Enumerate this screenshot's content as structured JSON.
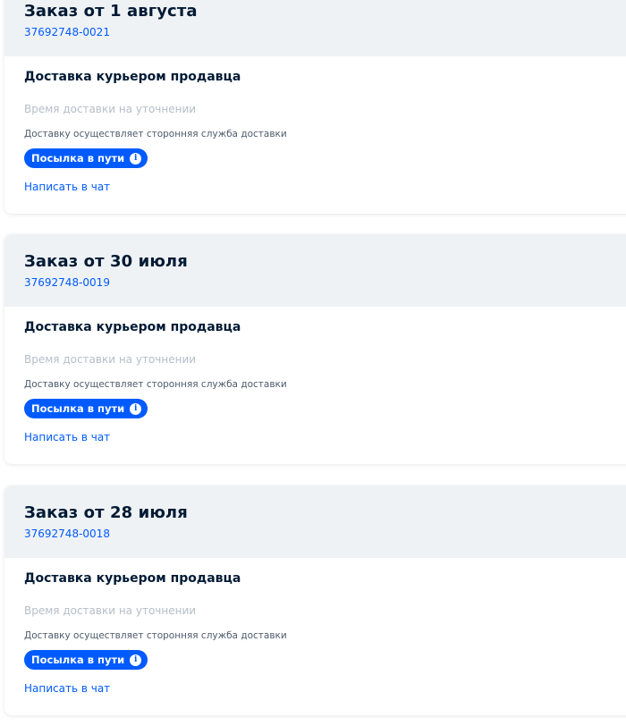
{
  "orders": [
    {
      "title": "Заказ от 1 августа",
      "number": "37692748-0021",
      "delivery_method": "Доставка курьером продавца",
      "delivery_time": "Время доставки на уточнении",
      "delivery_note": "Доставку осуществляет сторонняя служба доставки",
      "status": "Посылка в пути",
      "chat_link": "Написать в чат"
    },
    {
      "title": "Заказ от 30 июля",
      "number": "37692748-0019",
      "delivery_method": "Доставка курьером продавца",
      "delivery_time": "Время доставки на уточнении",
      "delivery_note": "Доставку осуществляет сторонняя служба доставки",
      "status": "Посылка в пути",
      "chat_link": "Написать в чат"
    },
    {
      "title": "Заказ от 28 июля",
      "number": "37692748-0018",
      "delivery_method": "Доставка курьером продавца",
      "delivery_time": "Время доставки на уточнении",
      "delivery_note": "Доставку осуществляет сторонняя служба доставки",
      "status": "Посылка в пути",
      "chat_link": "Написать в чат"
    }
  ],
  "info_icon_glyph": "i",
  "colors": {
    "accent": "#005bff",
    "header_bg": "#eff2f5",
    "title": "#001a34",
    "muted": "#b5bec9",
    "note": "#4d5b6b"
  }
}
